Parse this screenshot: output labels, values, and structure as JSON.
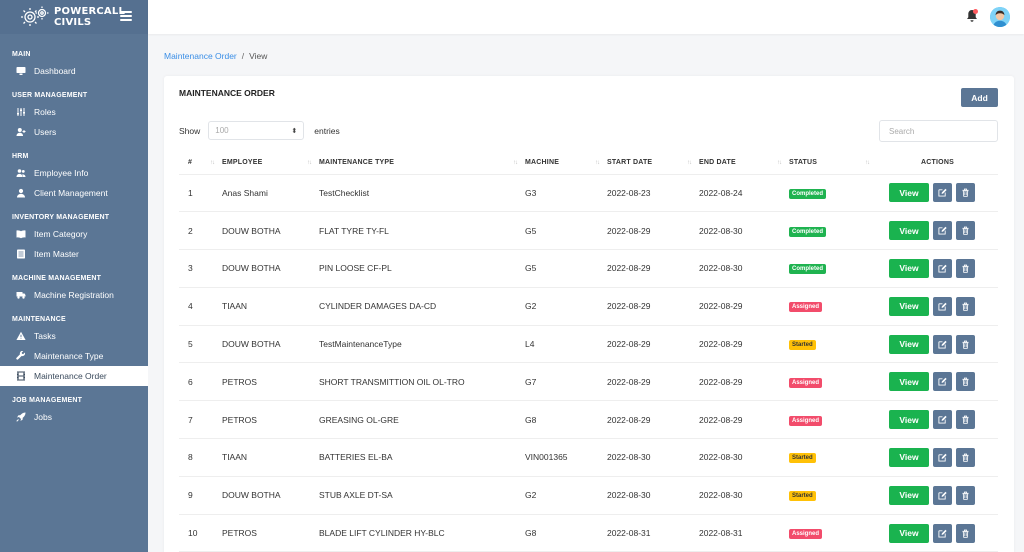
{
  "colors": {
    "sidebar": "#5b7695",
    "accent": "#5b7695",
    "completed": "#1fb350",
    "assigned": "#f24c6b",
    "started": "#ffc107",
    "view": "#1ab34f",
    "link": "#3a8ee6"
  },
  "brand": {
    "line1": "POWERCALL",
    "line2": "CIVILS"
  },
  "sidebar": {
    "sections": [
      {
        "title": "MAIN",
        "items": [
          {
            "label": "Dashboard",
            "icon": "monitor-icon"
          }
        ]
      },
      {
        "title": "USER MANAGEMENT",
        "items": [
          {
            "label": "Roles",
            "icon": "sliders-icon"
          },
          {
            "label": "Users",
            "icon": "user-plus-icon"
          }
        ]
      },
      {
        "title": "HRM",
        "items": [
          {
            "label": "Employee Info",
            "icon": "users-icon"
          },
          {
            "label": "Client Management",
            "icon": "user-icon"
          }
        ]
      },
      {
        "title": "INVENTORY MANAGEMENT",
        "items": [
          {
            "label": "Item Category",
            "icon": "book-icon"
          },
          {
            "label": "Item Master",
            "icon": "list-icon"
          }
        ]
      },
      {
        "title": "MACHINE MANAGEMENT",
        "items": [
          {
            "label": "Machine Registration",
            "icon": "truck-icon"
          }
        ]
      },
      {
        "title": "MAINTENANCE",
        "items": [
          {
            "label": "Tasks",
            "icon": "warning-icon"
          },
          {
            "label": "Maintenance Type",
            "icon": "wrench-icon"
          },
          {
            "label": "Maintenance Order",
            "icon": "film-icon",
            "active": true
          }
        ]
      },
      {
        "title": "JOB MANAGEMENT",
        "items": [
          {
            "label": "Jobs",
            "icon": "rocket-icon"
          }
        ]
      }
    ]
  },
  "breadcrumb": {
    "parent": "Maintenance Order",
    "separator": "/",
    "current": "View"
  },
  "card": {
    "title": "MAINTENANCE ORDER",
    "add_label": "Add",
    "show_label": "Show",
    "entries_value": "100",
    "entries_label": "entries",
    "search_placeholder": "Search"
  },
  "table": {
    "headers": [
      "#",
      "EMPLOYEE",
      "MAINTENANCE TYPE",
      "MACHINE",
      "START DATE",
      "END DATE",
      "STATUS",
      "ACTIONS"
    ],
    "view_label": "View",
    "rows": [
      {
        "num": "1",
        "employee": "Anas Shami",
        "type": "TestChecklist",
        "machine": "G3",
        "start": "2022-08-23",
        "end": "2022-08-24",
        "status": "Completed"
      },
      {
        "num": "2",
        "employee": "DOUW BOTHA",
        "type": "FLAT TYRE TY-FL",
        "machine": "G5",
        "start": "2022-08-29",
        "end": "2022-08-30",
        "status": "Completed"
      },
      {
        "num": "3",
        "employee": "DOUW BOTHA",
        "type": "PIN LOOSE CF-PL",
        "machine": "G5",
        "start": "2022-08-29",
        "end": "2022-08-30",
        "status": "Completed"
      },
      {
        "num": "4",
        "employee": "TIAAN",
        "type": "CYLINDER DAMAGES DA-CD",
        "machine": "G2",
        "start": "2022-08-29",
        "end": "2022-08-29",
        "status": "Assigned"
      },
      {
        "num": "5",
        "employee": "DOUW BOTHA",
        "type": "TestMaintenanceType",
        "machine": "L4",
        "start": "2022-08-29",
        "end": "2022-08-29",
        "status": "Started"
      },
      {
        "num": "6",
        "employee": "PETROS",
        "type": "SHORT TRANSMITTION OIL OL-TRO",
        "machine": "G7",
        "start": "2022-08-29",
        "end": "2022-08-29",
        "status": "Assigned"
      },
      {
        "num": "7",
        "employee": "PETROS",
        "type": "GREASING OL-GRE",
        "machine": "G8",
        "start": "2022-08-29",
        "end": "2022-08-29",
        "status": "Assigned"
      },
      {
        "num": "8",
        "employee": "TIAAN",
        "type": "BATTERIES EL-BA",
        "machine": "VIN001365",
        "start": "2022-08-30",
        "end": "2022-08-30",
        "status": "Started"
      },
      {
        "num": "9",
        "employee": "DOUW BOTHA",
        "type": "STUB AXLE DT-SA",
        "machine": "G2",
        "start": "2022-08-30",
        "end": "2022-08-30",
        "status": "Started"
      },
      {
        "num": "10",
        "employee": "PETROS",
        "type": "BLADE LIFT CYLINDER HY-BLC",
        "machine": "G8",
        "start": "2022-08-31",
        "end": "2022-08-31",
        "status": "Assigned"
      }
    ]
  }
}
